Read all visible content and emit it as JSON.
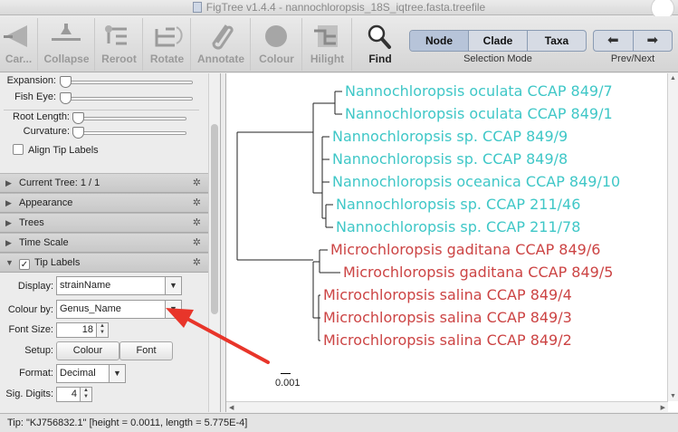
{
  "window": {
    "title": "FigTree v1.4.4 - nannochloropsis_18S_iqtree.fasta.treefile"
  },
  "toolbar": {
    "tools": [
      {
        "label": "Car...",
        "icon": "cartoon-icon",
        "enabled": false
      },
      {
        "label": "Collapse",
        "icon": "collapse-icon",
        "enabled": false
      },
      {
        "label": "Reroot",
        "icon": "reroot-icon",
        "enabled": false
      },
      {
        "label": "Rotate",
        "icon": "rotate-icon",
        "enabled": false
      },
      {
        "label": "Annotate",
        "icon": "paperclip-icon",
        "enabled": false
      },
      {
        "label": "Colour",
        "icon": "colour-icon",
        "enabled": false
      },
      {
        "label": "Hilight",
        "icon": "hilight-icon",
        "enabled": false
      },
      {
        "label": "Find",
        "icon": "magnifier-icon",
        "enabled": true
      }
    ],
    "selection_mode": {
      "options": [
        "Node",
        "Clade",
        "Taxa"
      ],
      "selected": "Node",
      "caption": "Selection Mode"
    },
    "prev_next": {
      "prev_icon": "arrow-left-icon",
      "next_icon": "arrow-right-icon",
      "caption": "Prev/Next"
    }
  },
  "sidebar": {
    "sliders": {
      "expansion": "Expansion:",
      "fish_eye": "Fish Eye:",
      "root_length": "Root Length:",
      "curvature": "Curvature:"
    },
    "align_tip_labels": {
      "label": "Align Tip Labels",
      "checked": false
    },
    "sections": [
      {
        "label": "Current Tree: 1 / 1",
        "expanded": false
      },
      {
        "label": "Appearance",
        "expanded": false
      },
      {
        "label": "Trees",
        "expanded": false
      },
      {
        "label": "Time Scale",
        "expanded": false
      },
      {
        "label": "Tip Labels",
        "expanded": true,
        "checked": true
      }
    ],
    "tip_labels": {
      "display_label": "Display:",
      "display_value": "strainName",
      "colour_by_label": "Colour by:",
      "colour_by_value": "Genus_Name",
      "font_size_label": "Font Size:",
      "font_size_value": "18",
      "setup_label": "Setup:",
      "colour_button": "Colour",
      "font_button": "Font",
      "format_label": "Format:",
      "format_value": "Decimal",
      "sig_digits_label": "Sig. Digits:",
      "sig_digits_value": "4"
    }
  },
  "tree": {
    "colors": {
      "Nannochloropsis": "#3fc7c7",
      "Microchloropsis": "#cc4444"
    },
    "tips": [
      {
        "label": "Nannochloropsis oculata CCAP 849/7",
        "group": "Nannochloropsis"
      },
      {
        "label": "Nannochloropsis oculata CCAP 849/1",
        "group": "Nannochloropsis"
      },
      {
        "label": "Nannochloropsis sp. CCAP 849/9",
        "group": "Nannochloropsis"
      },
      {
        "label": "Nannochloropsis sp. CCAP 849/8",
        "group": "Nannochloropsis"
      },
      {
        "label": "Nannochloropsis oceanica CCAP 849/10",
        "group": "Nannochloropsis"
      },
      {
        "label": "Nannochloropsis sp. CCAP 211/46",
        "group": "Nannochloropsis"
      },
      {
        "label": "Nannochloropsis sp. CCAP 211/78",
        "group": "Nannochloropsis"
      },
      {
        "label": "Microchloropsis gaditana CCAP 849/6",
        "group": "Microchloropsis"
      },
      {
        "label": "Microchloropsis gaditana CCAP 849/5",
        "group": "Microchloropsis"
      },
      {
        "label": "Microchloropsis salina CCAP 849/4",
        "group": "Microchloropsis"
      },
      {
        "label": "Microchloropsis salina CCAP 849/3",
        "group": "Microchloropsis"
      },
      {
        "label": "Microchloropsis salina CCAP 849/2",
        "group": "Microchloropsis"
      }
    ],
    "scale_label": "0.001"
  },
  "status": {
    "text": "Tip: \"KJ756832.1\" [height = 0.0011, length = 5.775E-4]"
  },
  "annotation": {
    "arrow_color": "#e8352a"
  }
}
